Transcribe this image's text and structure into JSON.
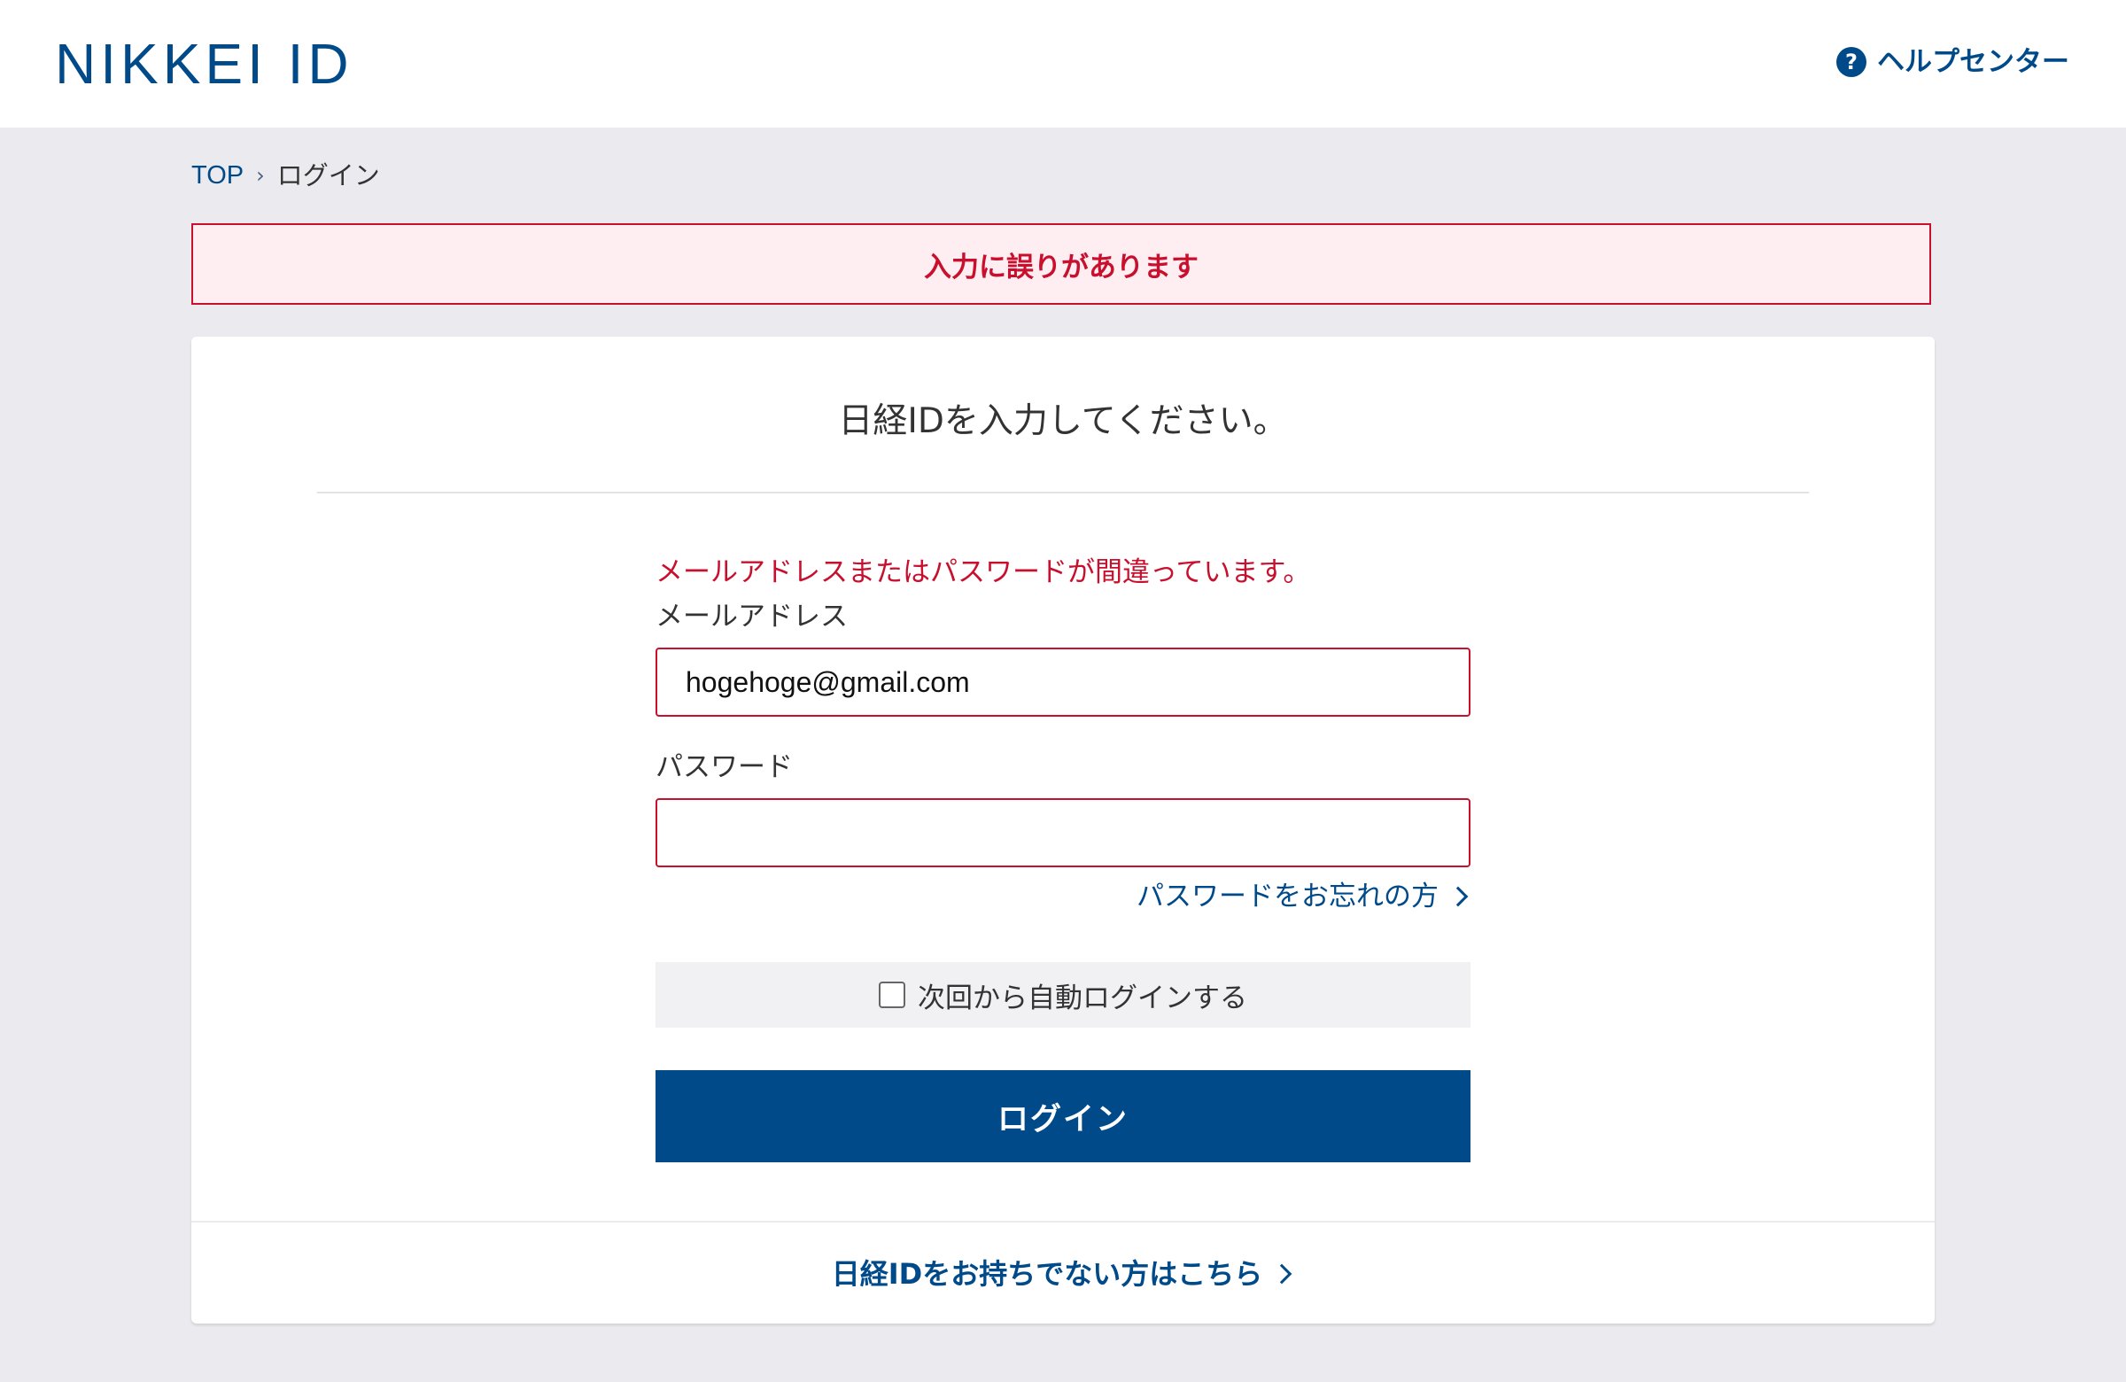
{
  "header": {
    "logo": "NIKKEI ID",
    "help_icon": "question-icon",
    "help_icon_glyph": "?",
    "help_label": "ヘルプセンター"
  },
  "breadcrumb": {
    "top": "TOP",
    "separator": "›",
    "current": "ログイン"
  },
  "error_banner": "入力に誤りがあります",
  "login_form": {
    "title": "日経IDを入力してください。",
    "error_message": "メールアドレスまたはパスワードが間違っています。",
    "email_label": "メールアドレス",
    "email_value": "hogehoge@gmail.com",
    "password_label": "パスワード",
    "password_value": "",
    "forgot_password": "パスワードをお忘れの方",
    "auto_login_label": "次回から自動ログインする",
    "auto_login_checked": false,
    "submit_label": "ログイン"
  },
  "signup_link": "日経IDをお持ちでない方はこちら",
  "colors": {
    "brand": "#004a8a",
    "error": "#c8102e",
    "error_bg": "#ffeef1",
    "page_bg": "#ebebef"
  }
}
